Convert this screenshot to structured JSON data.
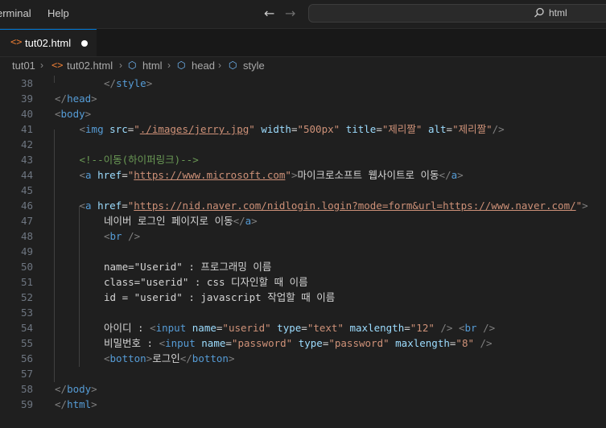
{
  "menu": {
    "terminal": "erminal",
    "help": "Help"
  },
  "command_center": {
    "text": "html"
  },
  "tab": {
    "label": "tut02.html",
    "icon": "<>"
  },
  "breadcrumb": {
    "items": [
      "tut01",
      "tut02.html",
      "html",
      "head",
      "style"
    ]
  },
  "editor": {
    "lines": [
      {
        "n": "38",
        "indent": 2,
        "tokens": [
          [
            "tg",
            "</"
          ],
          [
            "tn",
            "style"
          ],
          [
            "tg",
            ">"
          ]
        ]
      },
      {
        "n": "39",
        "indent": 0,
        "tokens": [
          [
            "tg",
            "</"
          ],
          [
            "tn",
            "head"
          ],
          [
            "tg",
            ">"
          ]
        ]
      },
      {
        "n": "40",
        "indent": 0,
        "tokens": [
          [
            "tg",
            "<"
          ],
          [
            "tn",
            "body"
          ],
          [
            "tg",
            ">"
          ]
        ]
      },
      {
        "n": "41",
        "indent": 1,
        "tokens": [
          [
            "tg",
            "<"
          ],
          [
            "tn",
            "img"
          ],
          [
            "tx",
            " "
          ],
          [
            "at",
            "src"
          ],
          [
            "tx",
            "="
          ],
          [
            "sv",
            "\""
          ],
          [
            "svu",
            "./images/jerry.jpg"
          ],
          [
            "sv",
            "\""
          ],
          [
            "tx",
            " "
          ],
          [
            "at",
            "width"
          ],
          [
            "tx",
            "="
          ],
          [
            "sv",
            "\"500px\""
          ],
          [
            "tx",
            " "
          ],
          [
            "at",
            "title"
          ],
          [
            "tx",
            "="
          ],
          [
            "sv",
            "\"제리짤\""
          ],
          [
            "tx",
            " "
          ],
          [
            "at",
            "alt"
          ],
          [
            "tx",
            "="
          ],
          [
            "sv",
            "\"제리짤\""
          ],
          [
            "tg",
            "/>"
          ]
        ]
      },
      {
        "n": "42",
        "indent": 0,
        "tokens": []
      },
      {
        "n": "43",
        "indent": 1,
        "tokens": [
          [
            "cm",
            "<!--이동(하이퍼링크)-->"
          ]
        ]
      },
      {
        "n": "44",
        "indent": 1,
        "tokens": [
          [
            "tg",
            "<"
          ],
          [
            "tn",
            "a"
          ],
          [
            "tx",
            " "
          ],
          [
            "at",
            "href"
          ],
          [
            "tx",
            "="
          ],
          [
            "sv",
            "\""
          ],
          [
            "svu",
            "https://www.microsoft.com"
          ],
          [
            "sv",
            "\""
          ],
          [
            "tg",
            ">"
          ],
          [
            "tx",
            "마이크로소프트 웹사이트로 이동"
          ],
          [
            "tg",
            "</"
          ],
          [
            "tn",
            "a"
          ],
          [
            "tg",
            ">"
          ]
        ]
      },
      {
        "n": "45",
        "indent": 0,
        "tokens": []
      },
      {
        "n": "46",
        "indent": 1,
        "tokens": [
          [
            "tg",
            "<"
          ],
          [
            "tn",
            "a"
          ],
          [
            "tx",
            " "
          ],
          [
            "at",
            "href"
          ],
          [
            "tx",
            "="
          ],
          [
            "sv",
            "\""
          ],
          [
            "svu",
            "https://nid.naver.com/nidlogin.login?mode=form&url=https://www.naver.com/"
          ],
          [
            "sv",
            "\""
          ],
          [
            "tg",
            ">"
          ]
        ]
      },
      {
        "n": "47",
        "indent": 2,
        "tokens": [
          [
            "tx",
            "네이버 로그인 페이지로 이동"
          ],
          [
            "tg",
            "</"
          ],
          [
            "tn",
            "a"
          ],
          [
            "tg",
            ">"
          ]
        ]
      },
      {
        "n": "48",
        "indent": 2,
        "tokens": [
          [
            "tg",
            "<"
          ],
          [
            "tn",
            "br"
          ],
          [
            "tx",
            " "
          ],
          [
            "tg",
            "/>"
          ]
        ]
      },
      {
        "n": "49",
        "indent": 0,
        "tokens": []
      },
      {
        "n": "50",
        "indent": 2,
        "tokens": [
          [
            "tx",
            "name=\"Userid\" : 프로그래밍 이름"
          ]
        ]
      },
      {
        "n": "51",
        "indent": 2,
        "tokens": [
          [
            "tx",
            "class=\"userid\" : css 디자인할 때 이름"
          ]
        ]
      },
      {
        "n": "52",
        "indent": 2,
        "tokens": [
          [
            "tx",
            "id = \"userid\" : javascript 작업할 때 이름"
          ]
        ]
      },
      {
        "n": "53",
        "indent": 0,
        "tokens": []
      },
      {
        "n": "54",
        "indent": 2,
        "tokens": [
          [
            "tx",
            "아이디 : "
          ],
          [
            "tg",
            "<"
          ],
          [
            "tn",
            "input"
          ],
          [
            "tx",
            " "
          ],
          [
            "at",
            "name"
          ],
          [
            "tx",
            "="
          ],
          [
            "sv",
            "\"userid\""
          ],
          [
            "tx",
            " "
          ],
          [
            "at",
            "type"
          ],
          [
            "tx",
            "="
          ],
          [
            "sv",
            "\"text\""
          ],
          [
            "tx",
            " "
          ],
          [
            "at",
            "maxlength"
          ],
          [
            "tx",
            "="
          ],
          [
            "sv",
            "\"12\""
          ],
          [
            "tx",
            " "
          ],
          [
            "tg",
            "/>"
          ],
          [
            "tx",
            " "
          ],
          [
            "tg",
            "<"
          ],
          [
            "tn",
            "br"
          ],
          [
            "tx",
            " "
          ],
          [
            "tg",
            "/>"
          ]
        ]
      },
      {
        "n": "55",
        "indent": 2,
        "tokens": [
          [
            "tx",
            "비밀번호 : "
          ],
          [
            "tg",
            "<"
          ],
          [
            "tn",
            "input"
          ],
          [
            "tx",
            " "
          ],
          [
            "at",
            "name"
          ],
          [
            "tx",
            "="
          ],
          [
            "sv",
            "\"password\""
          ],
          [
            "tx",
            " "
          ],
          [
            "at",
            "type"
          ],
          [
            "tx",
            "="
          ],
          [
            "sv",
            "\"password\""
          ],
          [
            "tx",
            " "
          ],
          [
            "at",
            "maxlength"
          ],
          [
            "tx",
            "="
          ],
          [
            "sv",
            "\"8\""
          ],
          [
            "tx",
            " "
          ],
          [
            "tg",
            "/>"
          ]
        ]
      },
      {
        "n": "56",
        "indent": 2,
        "tokens": [
          [
            "tg",
            "<"
          ],
          [
            "tn",
            "botton"
          ],
          [
            "tg",
            ">"
          ],
          [
            "tx",
            "로그인"
          ],
          [
            "tg",
            "</"
          ],
          [
            "tn",
            "botton"
          ],
          [
            "tg",
            ">"
          ]
        ]
      },
      {
        "n": "57",
        "indent": 0,
        "tokens": []
      },
      {
        "n": "58",
        "indent": 0,
        "tokens": [
          [
            "tg",
            "</"
          ],
          [
            "tn",
            "body"
          ],
          [
            "tg",
            ">"
          ]
        ]
      },
      {
        "n": "59",
        "indent": 0,
        "tokens": [
          [
            "tg",
            "</"
          ],
          [
            "tn",
            "html"
          ],
          [
            "tg",
            ">"
          ]
        ]
      }
    ]
  }
}
